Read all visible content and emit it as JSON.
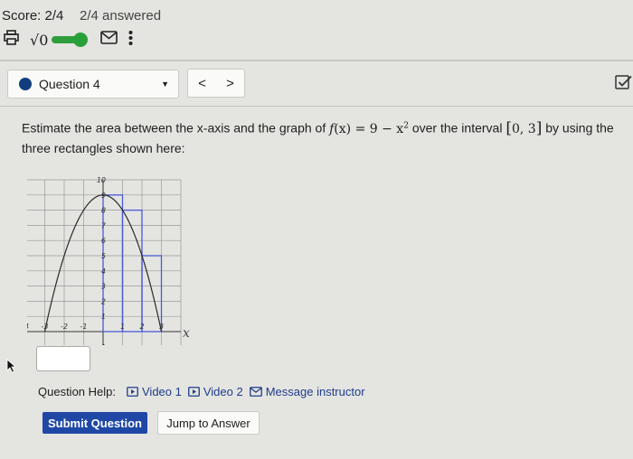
{
  "header": {
    "score": "Score: 2/4",
    "answered": "2/4 answered",
    "sqrt_label": "√0"
  },
  "question_nav": {
    "current": "Question 4",
    "prev": "<",
    "next": ">"
  },
  "question": {
    "prefix": "Estimate the area between the x-axis and the graph of",
    "function_f": "f",
    "function_x": "(x)",
    "function_rhs": " = 9 − x",
    "function_exp": "2",
    "middle": "over the interval",
    "interval": "0, 3",
    "suffix": "by using the",
    "line2": "three rectangles shown here:"
  },
  "chart_data": {
    "type": "line",
    "function": "9 - x^2",
    "x_ticks": [
      "-4",
      "-3",
      "-2",
      "-1",
      "1",
      "2",
      "3"
    ],
    "y_ticks": [
      "-1",
      "1",
      "2",
      "3",
      "4",
      "5",
      "6",
      "7",
      "8",
      "9",
      "10"
    ],
    "xlim": [
      -4,
      4
    ],
    "ylim": [
      -1,
      10
    ],
    "x_label": "x",
    "rectangles": [
      {
        "x0": 0,
        "x1": 1,
        "height": 9
      },
      {
        "x0": 1,
        "x1": 2,
        "height": 8
      },
      {
        "x0": 2,
        "x1": 3,
        "height": 5
      }
    ],
    "grid": true
  },
  "help": {
    "label": "Question Help:",
    "video1": "Video 1",
    "video2": "Video 2",
    "message": "Message instructor"
  },
  "buttons": {
    "submit": "Submit Question",
    "jump": "Jump to Answer"
  },
  "colors": {
    "curve": "#2a2a2a",
    "rectangles": "#4a5ad6",
    "toggle": "#2e9e3a",
    "submit": "#1f48a6",
    "question_dot": "#123e7e"
  }
}
